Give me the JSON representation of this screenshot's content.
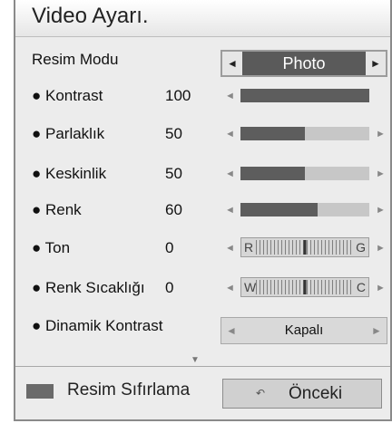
{
  "window": {
    "title": "Video Ayarı."
  },
  "picture_mode": {
    "label": "Resim Modu",
    "value": "Photo"
  },
  "settings": [
    {
      "label": "● Kontrast",
      "value": "100",
      "level": 1.0,
      "has_right_arrow": false
    },
    {
      "label": "● Parlaklık",
      "value": "50",
      "level": 0.5
    },
    {
      "label": "● Keskinlik",
      "value": "50",
      "level": 0.5
    },
    {
      "label": "● Renk",
      "value": "60",
      "level": 0.6
    }
  ],
  "tint": {
    "label": "● Ton",
    "value": "0",
    "left": "R",
    "right": "G"
  },
  "color_temp": {
    "label": "● Renk Sıcaklığı",
    "value": "0",
    "left": "W",
    "right": "C"
  },
  "dynamic_contrast": {
    "label": "● Dinamik Kontrast",
    "value": "Kapalı"
  },
  "glyphs": {
    "left": "◄",
    "right": "►",
    "down": "▼"
  },
  "footer": {
    "reset_label": "Resim Sıfırlama",
    "prev_label": "Önceki",
    "prev_icon": "↶"
  },
  "colors": {
    "fill": "#5d5d5d",
    "track": "#c7c7c7",
    "mode_bg": "#5a5a5a"
  }
}
